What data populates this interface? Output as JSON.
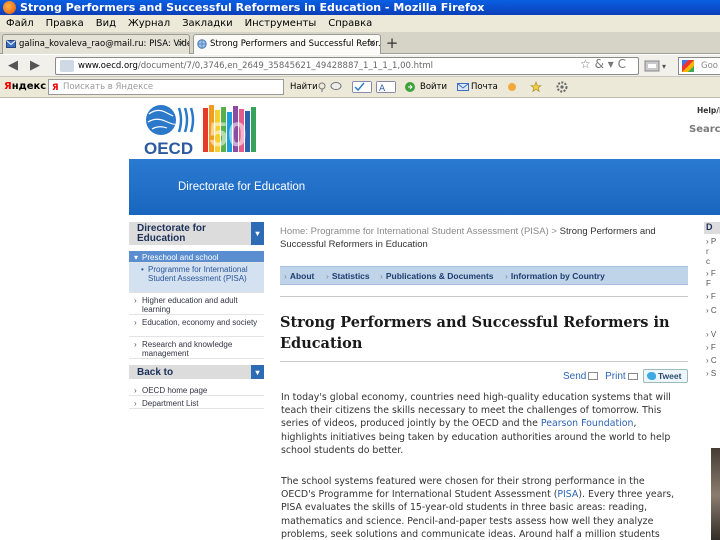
{
  "window": {
    "title": "Strong Performers and Successful Reformers in Education - Mozilla Firefox"
  },
  "menu": [
    "Файл",
    "Правка",
    "Вид",
    "Журнал",
    "Закладки",
    "Инструменты",
    "Справка"
  ],
  "tabs": [
    {
      "label": "galina_kovaleva_rao@mail.ru: PISA: Vide...",
      "close": "×"
    },
    {
      "label": "Strong Performers and Successful Refor...",
      "close": "×"
    }
  ],
  "new_tab": "+",
  "nav": {
    "back": "◀",
    "forward": "▶",
    "url_host": "www.oecd.org",
    "url_path": "/document/7/0,3746,en_2649_35845621_49428887_1_1_1_1,00.html",
    "url_icons": "☆ & ▾ C",
    "search_placeholder": "Goo"
  },
  "yandex": {
    "logo_y": "Я",
    "logo_rest": "ндекс",
    "search_placeholder": "Поискать в Яндексе",
    "find_label": "Найти",
    "go_label": "Войти",
    "mail_label": "Почта"
  },
  "site": {
    "logo_text": "OECD",
    "logo_number": "50",
    "help_text": "Help/F",
    "search_label": "Search",
    "banner_title": "Directorate for Education"
  },
  "leftnav": {
    "section1_title": "Directorate for Education",
    "items": [
      {
        "label": "Preschool and school"
      },
      {
        "label": "Programme for International Student Assessment (PISA)"
      },
      {
        "label": "Higher education and adult learning"
      },
      {
        "label": "Education, economy and society"
      },
      {
        "label": "Research and knowledge management"
      }
    ],
    "section2_title": "Back to",
    "back_items": [
      {
        "label": "OECD home page"
      },
      {
        "label": "Department List"
      }
    ]
  },
  "main": {
    "breadcrumb_link": "Home: Programme for International Student Assessment (PISA)",
    "breadcrumb_sep": ">",
    "breadcrumb_current": "Strong Performers and Successful Reformers in Education",
    "tabs": [
      "About",
      "Statistics",
      "Publications & Documents",
      "Information by Country"
    ],
    "heading": "Strong Performers and Successful Reformers in Education",
    "send_label": "Send",
    "print_label": "Print",
    "tweet_label": "Tweet",
    "p1_a": "In today's global economy, countries need high-quality education systems that will teach their citizens the skills necessary to meet the challenges of tomorrow. This series of videos, produced jointly by the OECD and the ",
    "p1_link": "Pearson Foundation",
    "p1_b": ", highlights initiatives being taken by education authorities around the world to help school students do better.",
    "p2_a": "The school systems featured were chosen for their strong performance in the OECD's Programme for International Student Assessment (",
    "p2_link": "PISA",
    "p2_b": "). Every three years, PISA evaluates the skills of 15-year-old students in three basic areas: reading, mathematics and science. Pencil-and-paper tests assess how well they analyze problems, seek solutions and communicate ideas. Around half a million students"
  },
  "rightcol": {
    "head": "D",
    "lines": [
      "› P",
      "r",
      "c",
      "› F",
      "F",
      "› F",
      "› C",
      "› V",
      "› F",
      "› C",
      "› S"
    ]
  }
}
